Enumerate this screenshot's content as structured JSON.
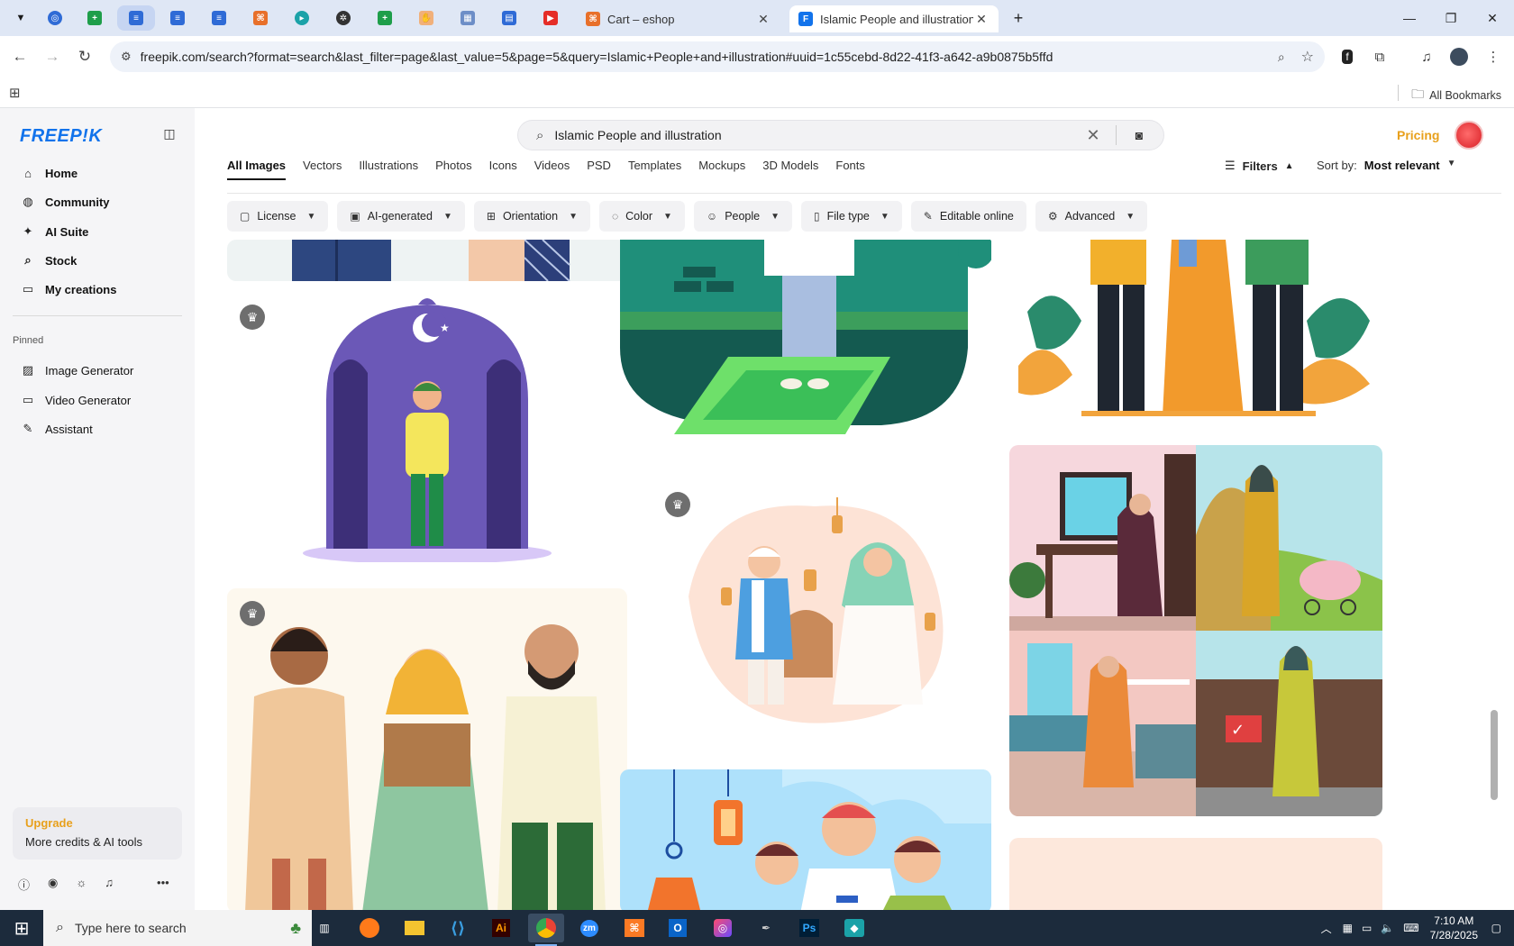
{
  "browser": {
    "tabs": [
      {
        "title": "Cart – eshop",
        "icon": "cart-icon"
      },
      {
        "title": "Islamic People and illustration v",
        "icon": "freepik-icon",
        "active": true
      }
    ],
    "new_tab": "+",
    "url": "freepik.com/search?format=search&last_filter=page&last_value=5&page=5&query=Islamic+People+and+illustration#uuid=1c55cebd-8d22-41f3-a642-a9b0875b5ffd",
    "all_bookmarks": "All Bookmarks"
  },
  "sidebar": {
    "logo": "FREEP!K",
    "nav": [
      {
        "label": "Home",
        "icon": "home-icon"
      },
      {
        "label": "Community",
        "icon": "globe-icon"
      },
      {
        "label": "AI Suite",
        "icon": "sparkle-icon"
      },
      {
        "label": "Stock",
        "icon": "search-icon"
      },
      {
        "label": "My creations",
        "icon": "folder-icon"
      }
    ],
    "pinned_label": "Pinned",
    "pinned": [
      {
        "label": "Image Generator",
        "icon": "image-icon"
      },
      {
        "label": "Video Generator",
        "icon": "video-icon"
      },
      {
        "label": "Assistant",
        "icon": "chat-icon"
      }
    ],
    "upgrade_title": "Upgrade",
    "upgrade_sub": "More credits & AI tools"
  },
  "header": {
    "search_query": "Islamic People and illustration",
    "pricing": "Pricing"
  },
  "categories": [
    "All Images",
    "Vectors",
    "Illustrations",
    "Photos",
    "Icons",
    "Videos",
    "PSD",
    "Templates",
    "Mockups",
    "3D Models",
    "Fonts"
  ],
  "filters_label": "Filters",
  "sort_label": "Sort by:",
  "sort_value": "Most relevant",
  "chips": [
    {
      "label": "License",
      "icon": "license-icon"
    },
    {
      "label": "AI-generated",
      "icon": "ai-icon"
    },
    {
      "label": "Orientation",
      "icon": "orientation-icon"
    },
    {
      "label": "Color",
      "icon": "palette-icon"
    },
    {
      "label": "People",
      "icon": "people-icon"
    },
    {
      "label": "File type",
      "icon": "file-icon"
    },
    {
      "label": "Editable online",
      "icon": "pen-icon"
    },
    {
      "label": "Advanced",
      "icon": "gear-icon"
    }
  ],
  "taskbar": {
    "search_placeholder": "Type here to search",
    "time": "7:10 AM",
    "date": "7/28/2025"
  },
  "colors": {
    "accent": "#1273eb",
    "pricing": "#e8a01c"
  }
}
